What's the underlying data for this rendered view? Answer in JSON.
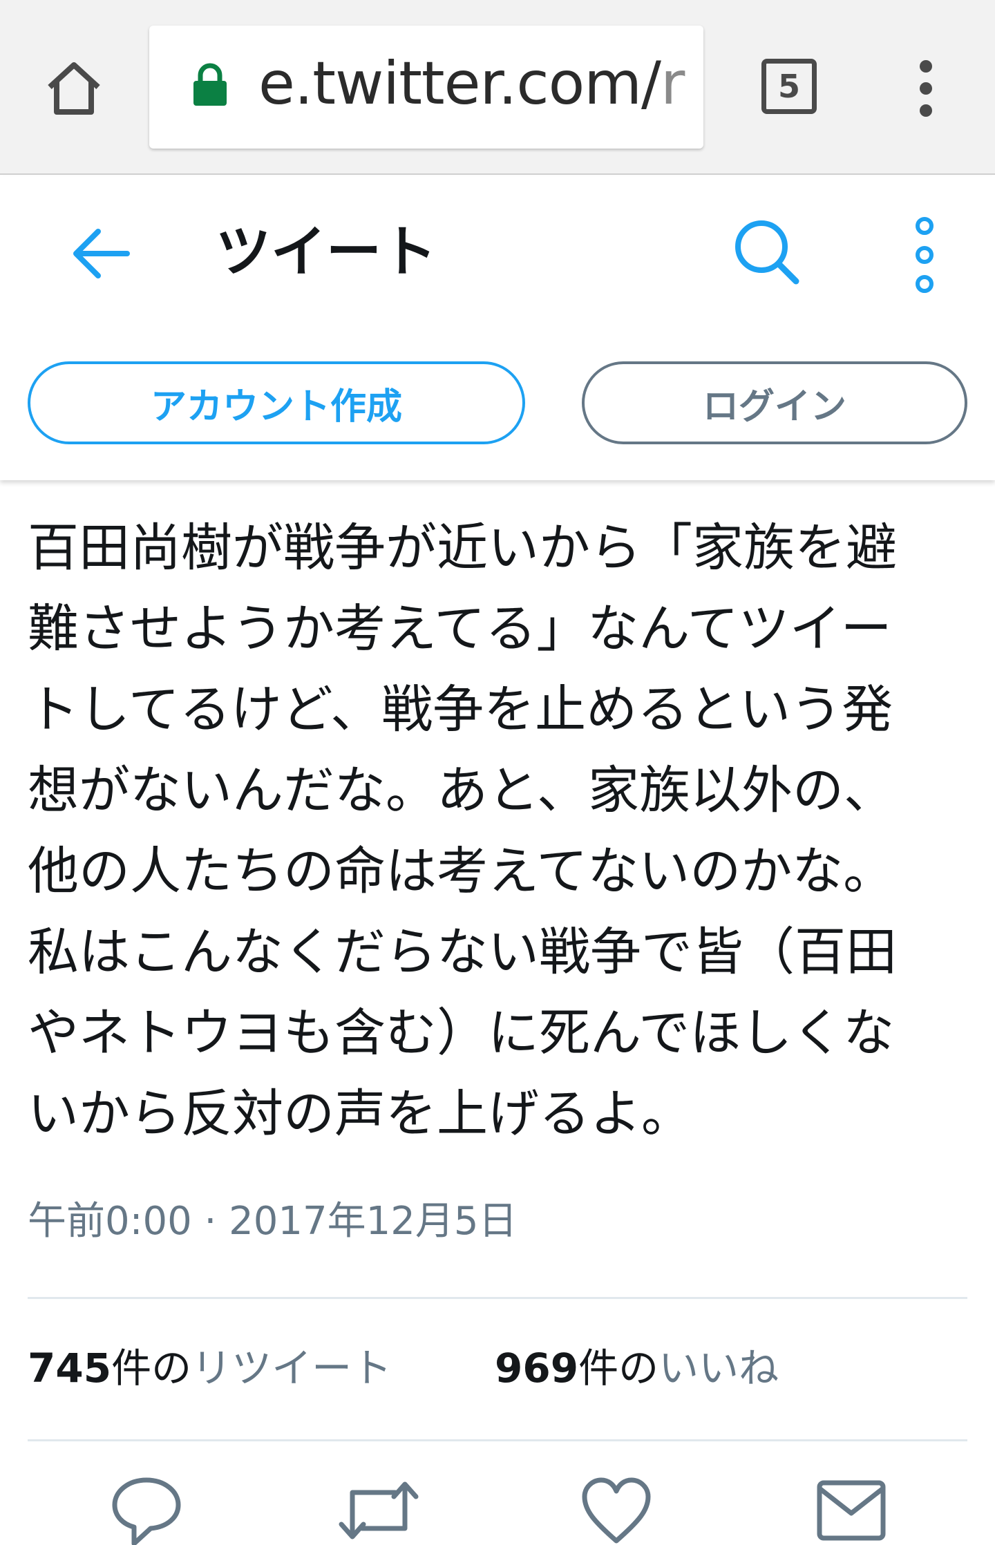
{
  "browser": {
    "url_host": "e.twitter.com/",
    "url_rest": "r",
    "tab_count": "5",
    "icons": [
      "home-icon",
      "lock-icon",
      "tabs-icon",
      "overflow-menu-icon"
    ]
  },
  "header": {
    "title": "ツイート",
    "signup_label": "アカウント作成",
    "login_label": "ログイン",
    "accent_color": "#1da1f2"
  },
  "tweet": {
    "lines": [
      "百田尚樹が戦争が近いから「家族を避",
      "難させようか考えてる」なんてツイー",
      "トしてるけど、戦争を止めるという発",
      "想がないんだな。あと、家族以外の、",
      "他の人たちの命は考えてないのかな。",
      "私はこんなくだらない戦争で皆（百田",
      "やネトウヨも含む）に死んでほしくな",
      "いから反対の声を上げるよ。"
    ],
    "timestamp": "午前0:00 · 2017年12月5日",
    "retweets": {
      "count": "745",
      "unit": "件の",
      "label": "リツイート"
    },
    "likes": {
      "count": "969",
      "unit": "件の",
      "label": "いいね"
    }
  }
}
